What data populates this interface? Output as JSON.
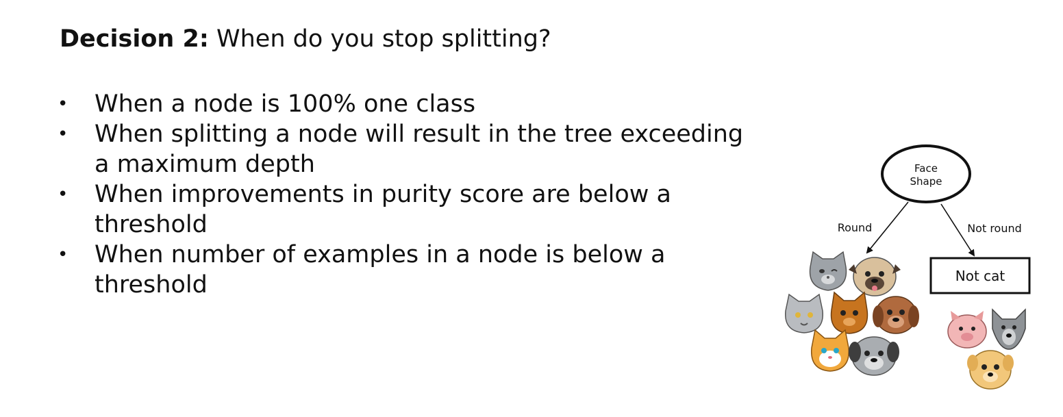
{
  "slide": {
    "title_bold": "Decision 2:",
    "title_rest": " When do you stop splitting?",
    "bullets": [
      {
        "line1": "When a node is 100% one class",
        "line2": ""
      },
      {
        "line1": "When splitting a node will result in the tree exceeding",
        "line2": "a maximum depth"
      },
      {
        "line1": "When improvements in purity score are below a",
        "line2": "threshold"
      },
      {
        "line1": "When number of examples in a node is below a",
        "line2": "threshold"
      }
    ]
  },
  "diagram": {
    "root_line1": "Face",
    "root_line2": "Shape",
    "left_edge_label": "Round",
    "right_edge_label": "Not round",
    "leaf_right": "Not cat",
    "icons": {
      "left_group": [
        "gray-cat-icon",
        "pug-dog-icon",
        "gray-cat-icon",
        "orange-cat-icon",
        "brown-dog-icon",
        "orange-white-cat-icon",
        "gray-dog-icon"
      ],
      "right_group": [
        "pink-pig-icon",
        "gray-wolf-icon",
        "yellow-dog-icon"
      ]
    }
  }
}
